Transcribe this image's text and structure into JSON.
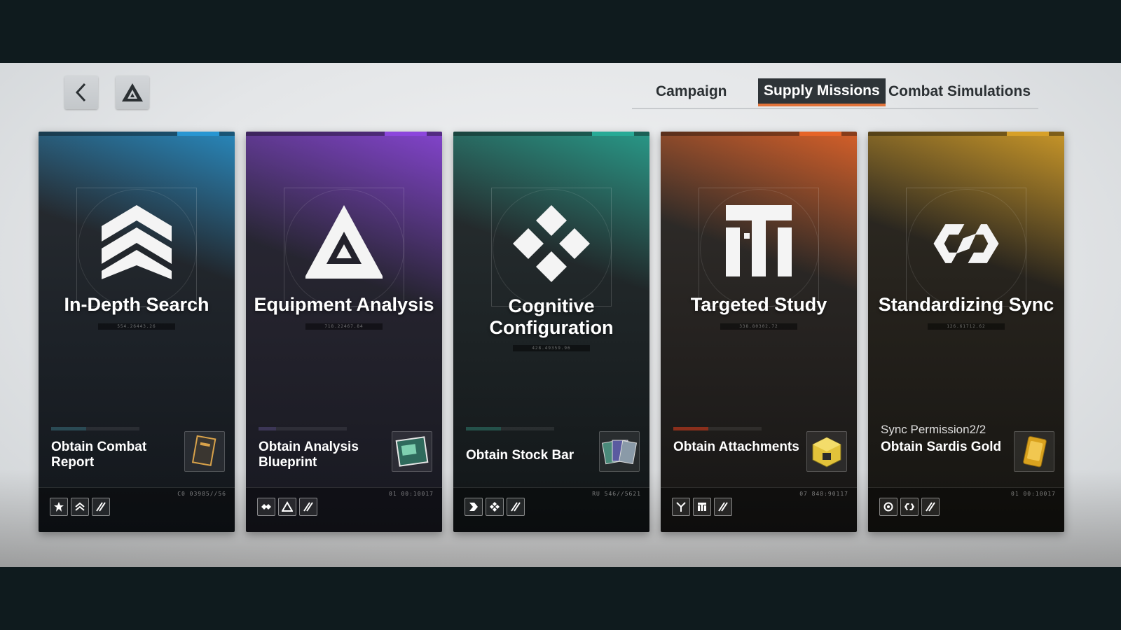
{
  "nav": {
    "back_icon": "chevron-left-icon",
    "logo_icon": "triangle-logo-icon"
  },
  "tabs": [
    {
      "label": "Campaign",
      "active": false
    },
    {
      "label": "Supply Missions",
      "active": true,
      "accent": "#e2733a"
    },
    {
      "label": "Combat Simulations",
      "active": false
    }
  ],
  "missions": [
    {
      "title": "In-Depth Search",
      "code": "554.26443.26",
      "accent": "#2896d2",
      "emblem_icon": "chevrons-up-icon",
      "reward": "Obtain Combat Report",
      "reward_icon": "combat-report-icon",
      "ref": "C0  03985//56",
      "badges": [
        "star-icon",
        "chevrons-up-icon",
        "stripes-icon"
      ]
    },
    {
      "title": "Equipment Analysis",
      "code": "718.22467.84",
      "accent": "#8c46dc",
      "emblem_icon": "delta-icon",
      "reward": "Obtain Analysis Blueprint",
      "reward_icon": "blueprint-icon",
      "ref": "01  00:10017",
      "badges": [
        "diamonds-icon",
        "delta-icon",
        "stripes-icon"
      ]
    },
    {
      "title": "Cognitive Configuration",
      "code": "428.49359.96",
      "accent": "#28aa96",
      "emblem_icon": "four-diamonds-icon",
      "reward": "Obtain Stock Bar",
      "reward_icon": "stock-bar-icon",
      "ref": "RU  546//5621",
      "badges": [
        "flag-icon",
        "four-diamonds-icon",
        "stripes-icon"
      ]
    },
    {
      "title": "Targeted Study",
      "code": "338.80302.72",
      "accent": "#e66428",
      "emblem_icon": "iti-icon",
      "reward": "Obtain Attachments",
      "reward_icon": "attachment-box-icon",
      "ref": "07  848:90117",
      "badges": [
        "y-icon",
        "iti-icon",
        "stripes-icon"
      ]
    },
    {
      "title": "Standardizing Sync",
      "code": "126.61712.62",
      "accent": "#d7a028",
      "emblem_icon": "link-icon",
      "sync": "Sync Permission2/2",
      "reward": "Obtain Sardis Gold",
      "reward_icon": "gold-bar-icon",
      "ref": "01  00:10017",
      "badges": [
        "ring-icon",
        "link-icon",
        "stripes-icon"
      ]
    }
  ]
}
